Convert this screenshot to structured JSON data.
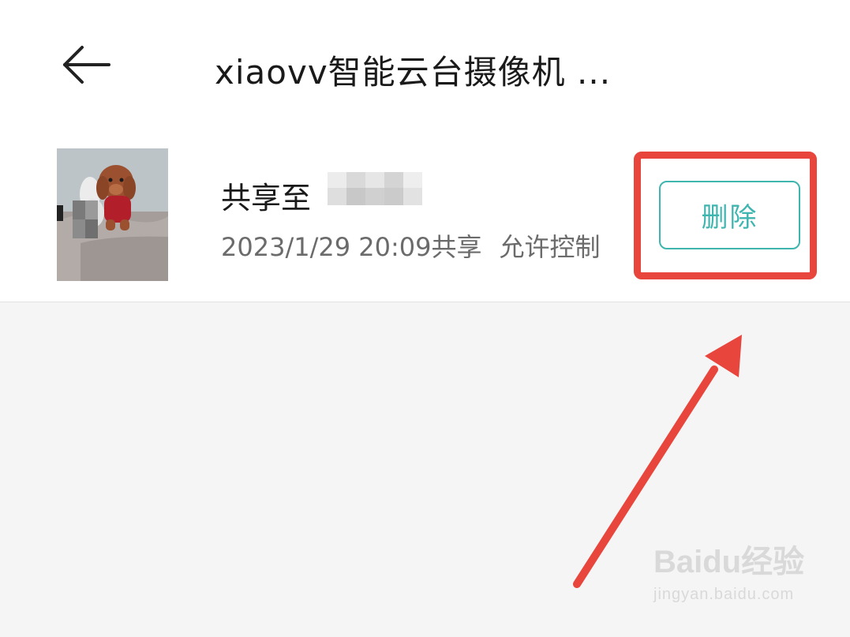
{
  "header": {
    "title": "xiaovv智能云台摄像机 ...",
    "back_icon": "arrow-left-icon"
  },
  "share_item": {
    "name_prefix": "共享至",
    "shared_time": "2023/1/29 20:09共享",
    "permission": "允许控制",
    "delete_label": "删除"
  },
  "colors": {
    "accent": "#3fb5b0",
    "annotation_red": "#e8453c",
    "background": "#f5f5f5",
    "card": "#ffffff",
    "secondary_text": "#6b6b6b"
  },
  "watermark": {
    "brand": "Baidu经验",
    "url": "jingyan.baidu.com"
  }
}
